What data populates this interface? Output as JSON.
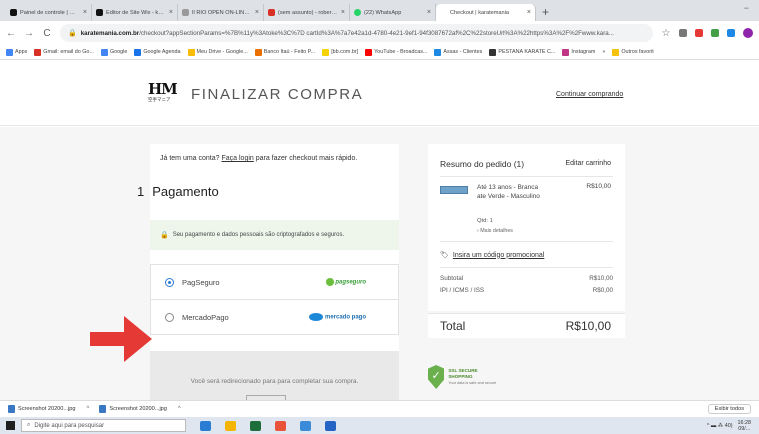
{
  "browser": {
    "tabs": [
      {
        "title": "Painel de controle | Wix.com",
        "color": "#111111"
      },
      {
        "title": "Editor de Site Wix - karatem",
        "color": "#111111"
      },
      {
        "title": "Il RIO OPEN ON-LINE | karat",
        "color": "#999999"
      },
      {
        "title": "(sem assunto) - robertopero",
        "color": "#d93025"
      },
      {
        "title": "(22) WhatsApp",
        "color": "#25d366"
      },
      {
        "title": "Checkout | karatemania",
        "color": "#cccccc",
        "active": true
      }
    ],
    "new_tab": "+",
    "minimize": "−",
    "nav": {
      "back": "←",
      "forward": "→",
      "reload": "C"
    },
    "url_domain": "karatemania.com.br",
    "url_rest": "/checkout?appSectionParams=%7B%11y%3Atoke%3C%7D cartId%3A%7a7e42a1d-4780-4e21-9ef1-94f3087672af%2C%22storeUrl%3A%22https%3A%2F%2Fwww.kara...",
    "url_lock": "🔒",
    "star": "☆",
    "bookmarks": [
      {
        "label": "Apps",
        "color": "#4285f4"
      },
      {
        "label": "Gmail: email do Go...",
        "color": "#d93025"
      },
      {
        "label": "Google",
        "color": "#4285f4"
      },
      {
        "label": "Google Agenda",
        "color": "#1a73e8"
      },
      {
        "label": "Meu Drive - Google...",
        "color": "#fbbc04"
      },
      {
        "label": "Banco Itaú - Feito P...",
        "color": "#ec7000"
      },
      {
        "label": "[bb.com.br]",
        "color": "#f5d300"
      },
      {
        "label": "YouTube - Broadcas...",
        "color": "#ff0000"
      },
      {
        "label": "Assas - Clientes",
        "color": "#1e88e5"
      },
      {
        "label": "PESTANA KARATE C...",
        "color": "#333333"
      },
      {
        "label": "Instagram",
        "color": "#c13584"
      },
      {
        "label": "»",
        "color": "#ffffff"
      },
      {
        "label": "Outros favorit",
        "color": "#f4c20d"
      }
    ]
  },
  "page": {
    "logo_main": "HM",
    "logo_sub": "空手マニア",
    "title": "FINALIZAR COMPRA",
    "continue_link": "Continuar comprando",
    "login_prefix": "Já tem uma conta?",
    "login_link": "Faça login",
    "login_suffix": "para fazer checkout mais rápido.",
    "step_number": "1",
    "step_title": "Pagamento",
    "secure_icon": "🔒",
    "secure_text": "Seu pagamento e dados pessoais são criptografados e seguros.",
    "payment_options": [
      {
        "label": "PagSeguro",
        "logo": "pagseguro",
        "selected": true
      },
      {
        "label": "MercadoPago",
        "logo": "mercado pago",
        "selected": false
      }
    ],
    "redirect_text": "Você será redirecionado para para completar sua compra.",
    "summary": {
      "title": "Resumo do pedido (1)",
      "edit_cart": "Editar carrinho",
      "product_name": "Até 13 anos - Branca ate Verde - Masculino",
      "product_price": "R$10,00",
      "product_qty": "Qtd: 1",
      "product_more": "› Mais detalhes",
      "promo_icon": "🏷",
      "promo_text": "Insira um código promocional",
      "subtotal_label": "Subtotal",
      "subtotal_value": "R$10,00",
      "tax_label": "IPI / ICMS / ISS",
      "tax_value": "R$0,00",
      "total_label": "Total",
      "total_value": "R$10,00"
    },
    "ssl_check": "✓",
    "ssl_title": "SSL SECURE SHOPPING",
    "ssl_sub": "Your data is safe and secure"
  },
  "downloads": {
    "items": [
      {
        "name": "Screenshot 20200...jpg"
      },
      {
        "name": "Screenshot 20200...jpg"
      }
    ],
    "show_all": "Exibir todos"
  },
  "taskbar": {
    "search_placeholder": "Digite aqui para pesquisar",
    "search_icon": "⌕",
    "apps": [
      "#2b7cd3",
      "#f4b400",
      "#1e6e3c",
      "#e8533a",
      "#3c8bd8",
      "#2563c5"
    ],
    "tray": "^ ▬ ⁂ 40)",
    "time": "16:28",
    "date": "09/..."
  },
  "colors": {
    "accent_blue": "#2a7ad5",
    "secure_green": "#4aa23b",
    "arrow_red": "#e53935"
  }
}
